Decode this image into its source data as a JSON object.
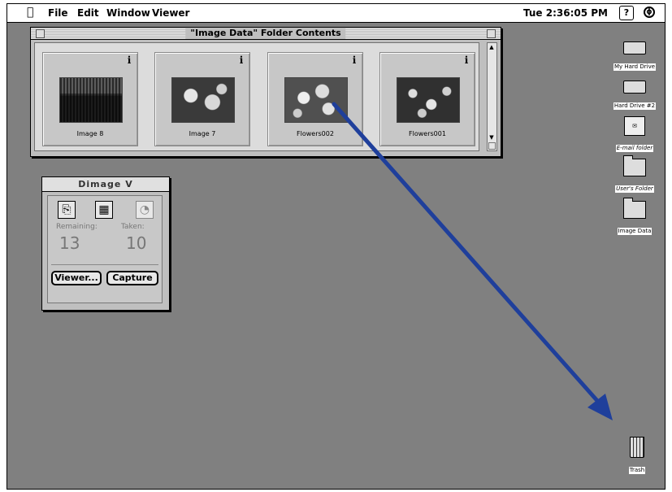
{
  "menubar": {
    "apple_icon": "apple-menu-icon",
    "items": [
      "File",
      "Edit",
      "Window",
      "Viewer"
    ],
    "clock": "Tue 2:36:05 PM",
    "help_icon_glyph": "?",
    "app_icon_glyph": "ɸ"
  },
  "folder_window": {
    "title": "\"Image Data\" Folder Contents",
    "info_glyph": "i",
    "thumbnails": [
      {
        "label": "Image 8"
      },
      {
        "label": "Image 7"
      },
      {
        "label": "Flowers002"
      },
      {
        "label": "Flowers001"
      }
    ]
  },
  "dimage_window": {
    "title": "Dimage V",
    "tools": {
      "tool1": "camera-tool-icon",
      "tool2": "checkered-tool-icon",
      "tool3": "timer-tool-icon"
    },
    "remaining_label": "Remaining:",
    "taken_label": "Taken:",
    "remaining_value": "13",
    "taken_value": "10",
    "viewer_button": "Viewer...",
    "capture_button": "Capture"
  },
  "desktop_icons": [
    {
      "label": "My Hard Drive"
    },
    {
      "label": "Hard Drive #2"
    },
    {
      "label": "E-mail folder"
    },
    {
      "label": "User's Folder"
    },
    {
      "label": "Image Data"
    },
    {
      "label": "Trash"
    }
  ],
  "colors": {
    "desktop": "#808080",
    "arrow": "#1f3f9b"
  }
}
